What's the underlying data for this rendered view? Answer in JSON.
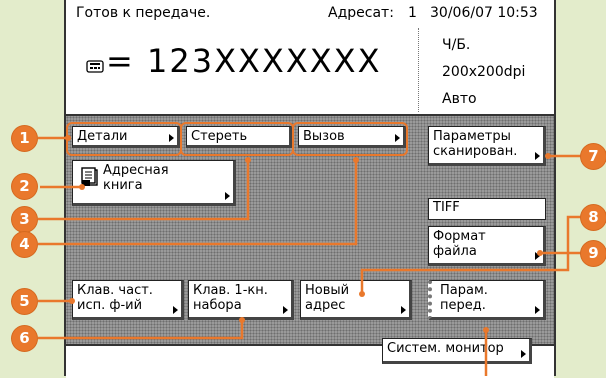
{
  "status": {
    "message": "Готов к передаче.",
    "dest_label": "Адресат:",
    "dest_count": "1",
    "datetime": "30/06/07 10:53"
  },
  "number_display": {
    "icon": "fax-memory-icon",
    "prefix": "=",
    "number": "123XXXXXXX"
  },
  "settings": {
    "color_mode": "Ч/Б.",
    "resolution": "200x200dpi",
    "density": "Авто"
  },
  "buttons": {
    "details": "Детали",
    "delete": "Стереть",
    "recall": "Вызов",
    "scan_settings_1": "Параметры",
    "scan_settings_2": "сканирован.",
    "address_book_1": "Адресная",
    "address_book_2": "книга",
    "file_type_value": "TIFF",
    "file_format_1": "Формат",
    "file_format_2": "файла",
    "favorites_1": "Клав. част.",
    "favorites_2": "исп. ф-ий",
    "one_touch_1": "Клав. 1-кн.",
    "one_touch_2": "набора",
    "new_address_1": "Новый",
    "new_address_2": "адрес",
    "send_settings_1": "Парам.",
    "send_settings_2": "перед.",
    "system_monitor": "Систем. монитор"
  },
  "callouts": [
    "1",
    "2",
    "3",
    "4",
    "5",
    "6",
    "7",
    "8",
    "9"
  ],
  "colors": {
    "callout": "#e9782c",
    "background": "#e3eccb",
    "panel": "#9a9a9a"
  }
}
